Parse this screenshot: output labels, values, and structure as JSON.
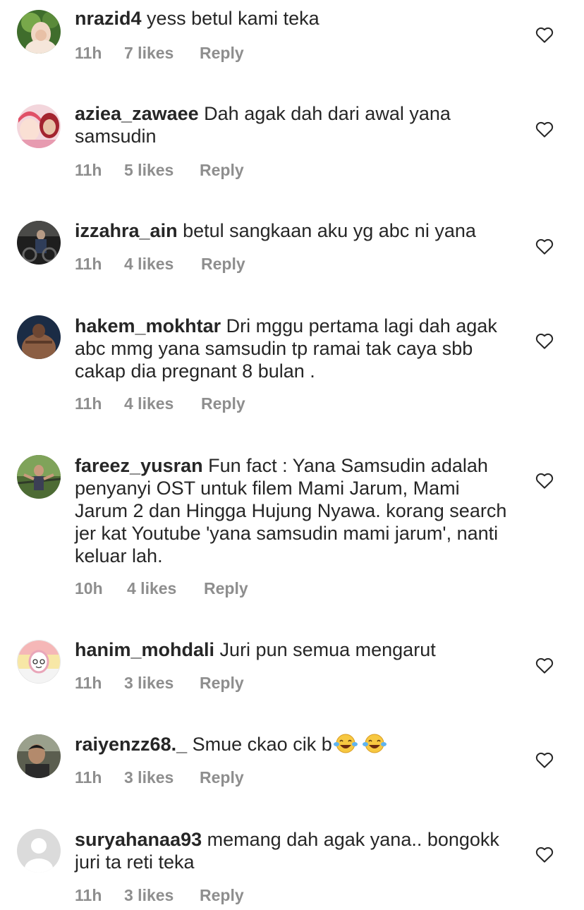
{
  "comments": [
    {
      "username": "nrazid4",
      "text": "yess betul kami teka",
      "time": "11h",
      "likes": "7 likes",
      "reply": "Reply"
    },
    {
      "username": "aziea_zawaee",
      "text": "Dah agak dah dari awal yana samsudin",
      "time": "11h",
      "likes": "5 likes",
      "reply": "Reply"
    },
    {
      "username": "izzahra_ain",
      "text": "betul sangkaan aku yg abc ni yana",
      "time": "11h",
      "likes": "4 likes",
      "reply": "Reply"
    },
    {
      "username": "hakem_mokhtar",
      "text": "Dri mggu pertama lagi dah agak abc mmg yana samsudin tp ramai tak caya sbb cakap dia pregnant 8 bulan .",
      "time": "11h",
      "likes": "4 likes",
      "reply": "Reply"
    },
    {
      "username": "fareez_yusran",
      "text": "Fun fact : Yana Samsudin adalah penyanyi OST untuk filem Mami Jarum, Mami Jarum 2 dan Hingga Hujung Nyawa. korang search jer kat Youtube 'yana samsudin mami jarum', nanti keluar lah.",
      "time": "10h",
      "likes": "4 likes",
      "reply": "Reply"
    },
    {
      "username": "hanim_mohdali",
      "text": "Juri pun semua mengarut",
      "time": "11h",
      "likes": "3 likes",
      "reply": "Reply"
    },
    {
      "username": "raiyenzz68._",
      "text": "Smue ckao cik b",
      "time": "11h",
      "likes": "3 likes",
      "reply": "Reply",
      "emoji": "face-with-tears-of-joy x2"
    },
    {
      "username": "suryahanaa93",
      "text": "memang dah agak yana.. bongokk juri ta reti teka",
      "time": "11h",
      "likes": "3 likes",
      "reply": "Reply"
    }
  ],
  "icons": {
    "like": "heart-outline-icon"
  },
  "colors": {
    "text": "#262626",
    "meta": "#8e8e8e",
    "background": "#ffffff"
  }
}
